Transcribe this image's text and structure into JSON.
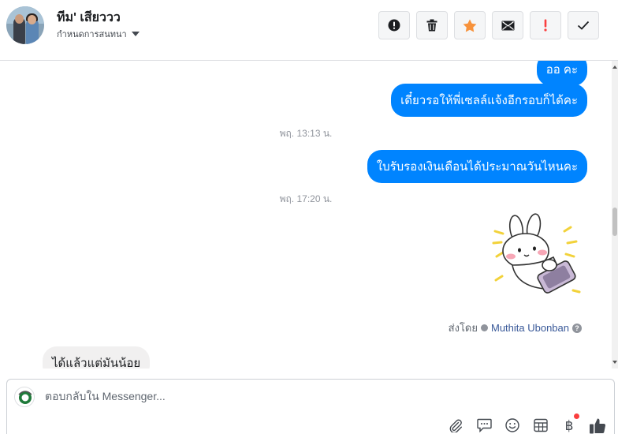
{
  "header": {
    "contact_name": "ทีม' เสียววว",
    "assign_label": "กำหนดการสนทนา",
    "actions": [
      {
        "name": "spam",
        "icon": "alert-circle-icon"
      },
      {
        "name": "delete",
        "icon": "trash-icon"
      },
      {
        "name": "star",
        "icon": "star-icon",
        "color": "#f7923b"
      },
      {
        "name": "mark-unread",
        "icon": "envelope-icon"
      },
      {
        "name": "follow-up",
        "icon": "exclamation-icon",
        "color": "#fa3e3e"
      },
      {
        "name": "done",
        "icon": "checkmark-icon"
      }
    ]
  },
  "thread": {
    "messages": [
      {
        "type": "out",
        "text": "ออ คะ"
      },
      {
        "type": "out",
        "text": "เดี๋ยวรอให้พี่เซลล์แจ้งอีกรอบก็ได้คะ"
      },
      {
        "type": "timestamp",
        "text": "พฤ. 13:13 น."
      },
      {
        "type": "out",
        "text": "ใบรับรองเงินเดือนได้ประมาณวันไหนคะ"
      },
      {
        "type": "timestamp",
        "text": "พฤ. 17:20 น."
      },
      {
        "type": "sticker",
        "icon": "bunny-phone-sticker"
      },
      {
        "type": "in",
        "text": "ได้แล้วแต่มันน้อย"
      }
    ],
    "sent_by_label": "ส่งโดย",
    "sent_by_name": "Muthita Ubonban"
  },
  "composer": {
    "placeholder": "ตอบกลับใน Messenger...",
    "tools": [
      "paperclip-icon",
      "speech-bubble-icon",
      "emoji-icon",
      "table-icon",
      "baht-icon",
      "thumbs-up-icon"
    ],
    "baht_symbol": "฿",
    "like_color": "#444950"
  },
  "colors": {
    "outgoing_bubble": "#0084ff",
    "incoming_bubble": "#f1f0f0",
    "notification_dot": "#fa3e3e"
  }
}
